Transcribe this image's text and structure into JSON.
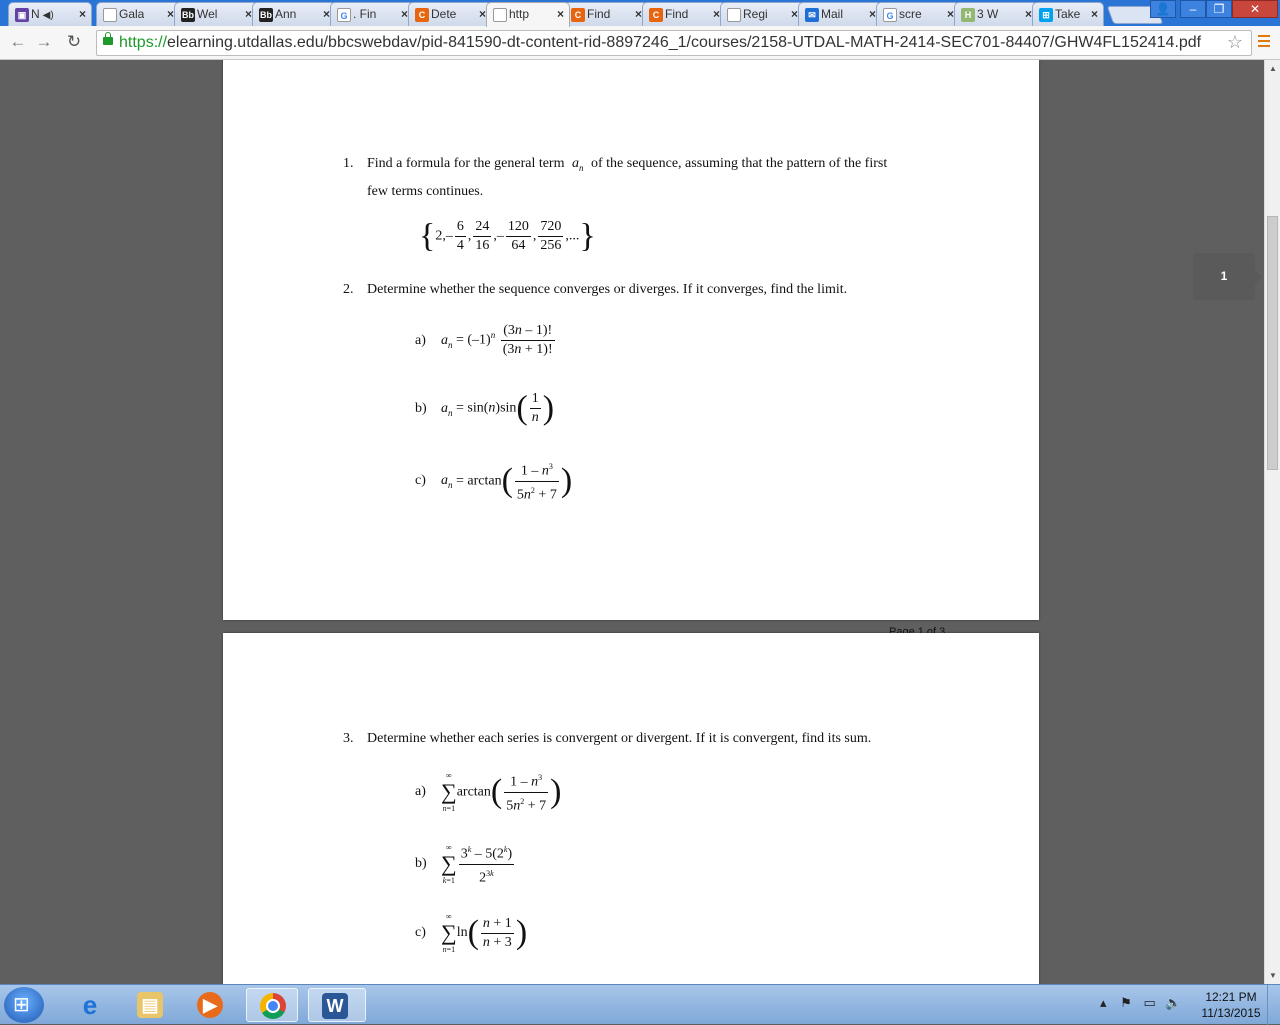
{
  "tabs": [
    {
      "label": "N",
      "icon": "twitch-icon",
      "color": "#6441a5",
      "glyph": "▣",
      "audio": true
    },
    {
      "label": "Gala",
      "icon": "doc-icon",
      "color": "#ffffff",
      "glyph": ""
    },
    {
      "label": "Wel",
      "icon": "blackboard-icon",
      "color": "#222222",
      "glyph": "Bb"
    },
    {
      "label": "Ann",
      "icon": "blackboard-icon",
      "color": "#222222",
      "glyph": "Bb"
    },
    {
      "label": ". Fin",
      "icon": "google-icon",
      "color": "#ffffff",
      "glyph": "G"
    },
    {
      "label": "Dete",
      "icon": "chegg-icon",
      "color": "#e8650f",
      "glyph": "C"
    },
    {
      "label": "http",
      "icon": "doc-icon",
      "color": "#ffffff",
      "glyph": "",
      "active": true
    },
    {
      "label": "Find",
      "icon": "chegg-icon",
      "color": "#e8650f",
      "glyph": "C"
    },
    {
      "label": "Find",
      "icon": "chegg-icon",
      "color": "#e8650f",
      "glyph": "C"
    },
    {
      "label": "Regi",
      "icon": "doc-icon",
      "color": "#ffffff",
      "glyph": ""
    },
    {
      "label": "Mail",
      "icon": "mail-icon",
      "color": "#1e6fd6",
      "glyph": "✉"
    },
    {
      "label": "scre",
      "icon": "google-icon",
      "color": "#ffffff",
      "glyph": "G"
    },
    {
      "label": "3 W",
      "icon": "wikihow-icon",
      "color": "#93b874",
      "glyph": "H"
    },
    {
      "label": "Take",
      "icon": "windows-icon",
      "color": "#00a2ed",
      "glyph": "⊞"
    }
  ],
  "toolbar": {
    "url_scheme": "https://",
    "url_rest": "elearning.utdallas.edu/bbcswebdav/pid-841590-dt-content-rid-8897246_1/courses/2158-UTDAL-MATH-2414-SEC701-84407/GHW4FL152414.pdf"
  },
  "doc": {
    "p1_num": "1.",
    "p1_text_a": "Find a formula for the general term",
    "p1_term": "a",
    "p1_sub": "n",
    "p1_text_b": "of the sequence, assuming that the pattern of the first",
    "p1_text_c": "few terms continues.",
    "p2_num": "2.",
    "p2_text": "Determine whether the sequence converges or diverges. If it converges, find the limit.",
    "p3_num": "3.",
    "p3_text": "Determine whether each series is convergent or divergent. If it is convergent, find its sum.",
    "a_label": "a)",
    "b_label": "b)",
    "c_label": "c)",
    "footer": "Page 1 of 3"
  },
  "page_indicator": "1",
  "clock": {
    "time": "12:21 PM",
    "date": "11/13/2015"
  }
}
